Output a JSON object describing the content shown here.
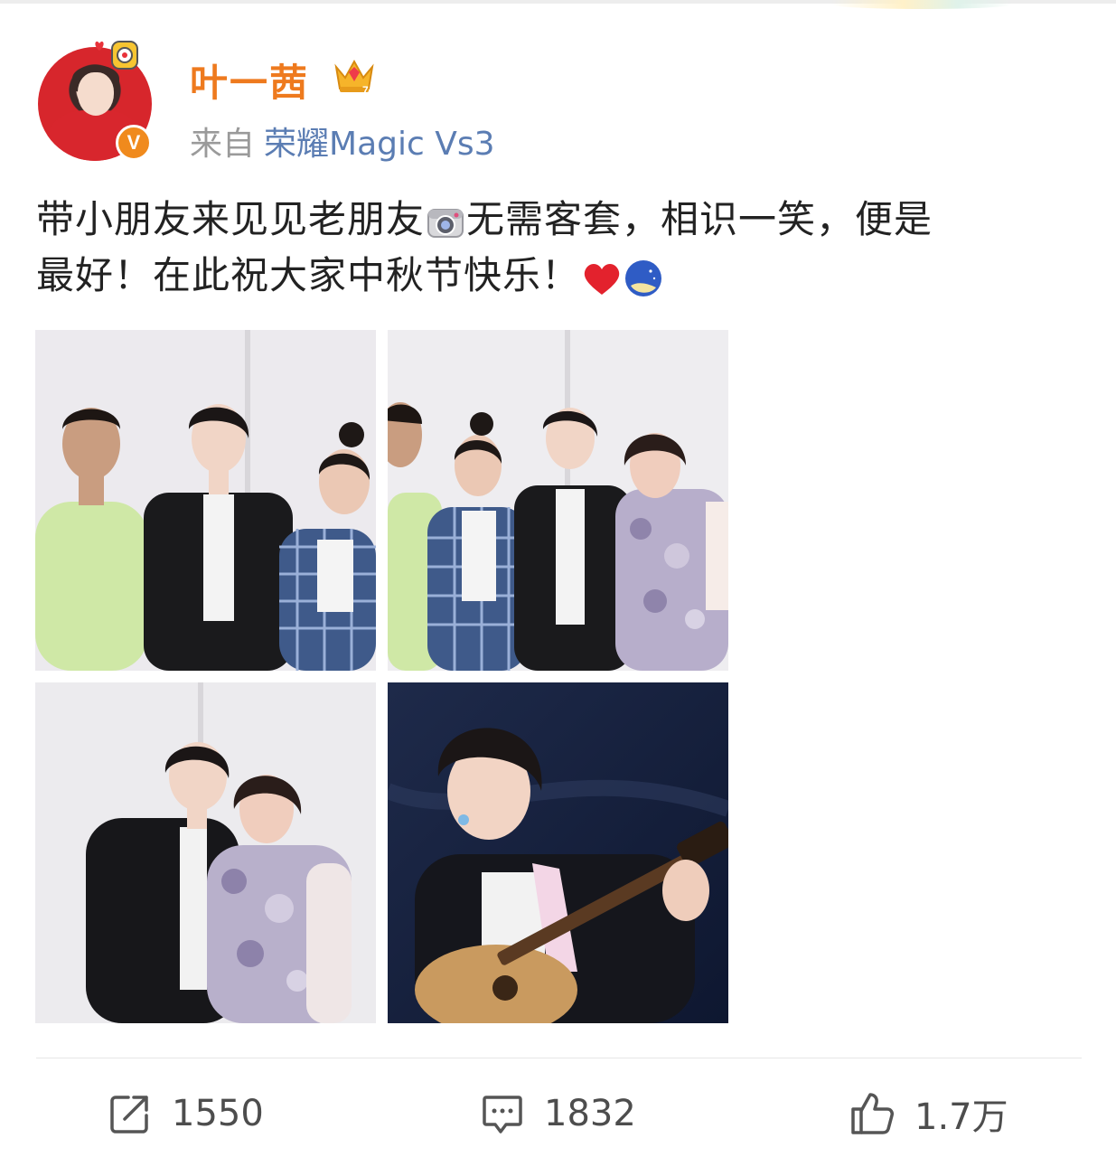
{
  "post": {
    "author": {
      "name": "叶一茜",
      "verified_badge": "V",
      "source_prefix": "来自",
      "device": "荣耀Magic Vs3"
    },
    "text_line1": "带小朋友来见见老朋友",
    "text_line1b": "无需客套，相识一笑，便是",
    "text_line2": "最好！在此祝大家中秋节快乐！",
    "icons": [
      "crown-icon",
      "camera-icon",
      "heart-icon",
      "moon-icon"
    ],
    "photos": [
      {
        "label": "group-photo-1"
      },
      {
        "label": "group-photo-2"
      },
      {
        "label": "duo-photo"
      },
      {
        "label": "guitar-stage-photo"
      }
    ]
  },
  "actions": {
    "repost_count": "1550",
    "comment_count": "1832",
    "like_count": "1.7万"
  },
  "colors": {
    "username": "#ee7a1e",
    "device_link": "#5b7db3",
    "verified": "#f08a1d",
    "text": "#222222"
  }
}
